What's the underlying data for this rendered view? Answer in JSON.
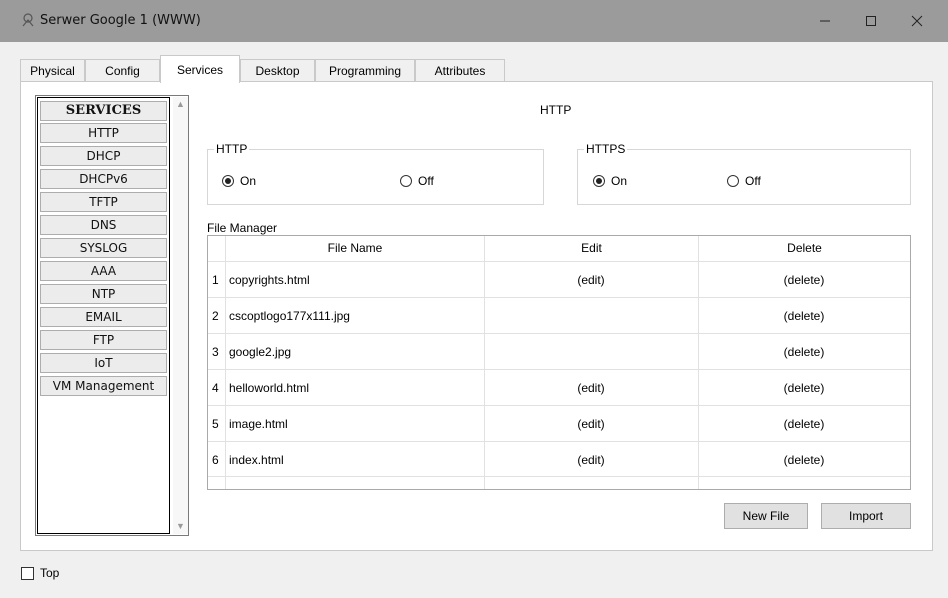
{
  "window": {
    "title": "Serwer Google 1 (WWW)",
    "controls": {
      "minimize": "—",
      "maximize": "☐",
      "close": "✕"
    }
  },
  "tabs": [
    {
      "label": "Physical",
      "active": false
    },
    {
      "label": "Config",
      "active": false
    },
    {
      "label": "Services",
      "active": true
    },
    {
      "label": "Desktop",
      "active": false
    },
    {
      "label": "Programming",
      "active": false
    },
    {
      "label": "Attributes",
      "active": false
    }
  ],
  "services": {
    "header": "SERVICES",
    "items": [
      "HTTP",
      "DHCP",
      "DHCPv6",
      "TFTP",
      "DNS",
      "SYSLOG",
      "AAA",
      "NTP",
      "EMAIL",
      "FTP",
      "IoT",
      "VM Management"
    ]
  },
  "http_panel": {
    "title": "HTTP",
    "http_group": {
      "legend": "HTTP",
      "on_label": "On",
      "off_label": "Off",
      "selected": "On"
    },
    "https_group": {
      "legend": "HTTPS",
      "on_label": "On",
      "off_label": "Off",
      "selected": "On"
    }
  },
  "file_manager": {
    "label": "File Manager",
    "columns": {
      "name": "File Name",
      "edit": "Edit",
      "delete": "Delete"
    },
    "rows": [
      {
        "num": "1",
        "name": "copyrights.html",
        "edit": "(edit)",
        "delete": "(delete)"
      },
      {
        "num": "2",
        "name": "cscoptlogo177x111.jpg",
        "edit": "",
        "delete": "(delete)"
      },
      {
        "num": "3",
        "name": "google2.jpg",
        "edit": "",
        "delete": "(delete)"
      },
      {
        "num": "4",
        "name": "helloworld.html",
        "edit": "(edit)",
        "delete": "(delete)"
      },
      {
        "num": "5",
        "name": "image.html",
        "edit": "(edit)",
        "delete": "(delete)"
      },
      {
        "num": "6",
        "name": "index.html",
        "edit": "(edit)",
        "delete": "(delete)"
      }
    ],
    "new_file_label": "New File",
    "import_label": "Import"
  },
  "footer": {
    "top_label": "Top",
    "top_checked": false
  }
}
